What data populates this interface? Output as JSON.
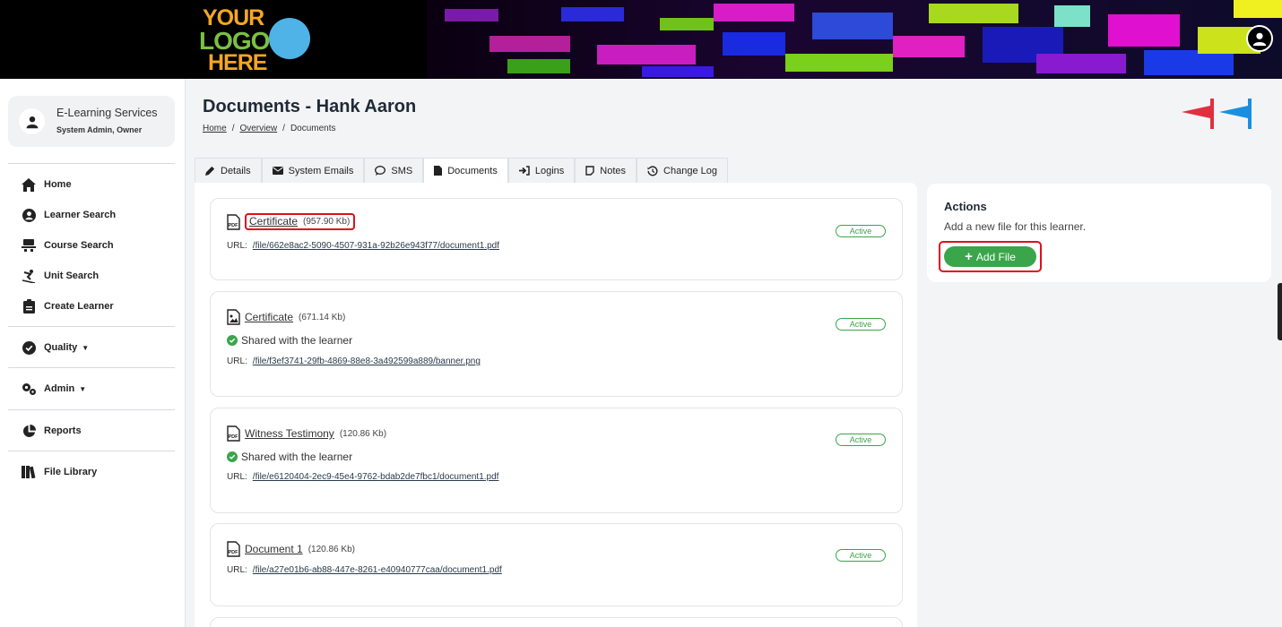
{
  "header": {
    "logo": {
      "line1": "YOUR",
      "line2": "LOGO",
      "line3": "HERE"
    }
  },
  "sidebar": {
    "profile": {
      "name": "E-Learning Services",
      "role": "System Admin, Owner"
    },
    "items": [
      {
        "label": "Home",
        "icon": "home-icon"
      },
      {
        "label": "Learner Search",
        "icon": "user-circle-icon"
      },
      {
        "label": "Course Search",
        "icon": "course-icon"
      },
      {
        "label": "Unit Search",
        "icon": "skier-icon"
      },
      {
        "label": "Create Learner",
        "icon": "clipboard-icon"
      },
      {
        "label": "Quality",
        "icon": "check-circle-icon",
        "dropdown": true
      },
      {
        "label": "Admin",
        "icon": "cogs-icon",
        "dropdown": true
      },
      {
        "label": "Reports",
        "icon": "pie-chart-icon"
      },
      {
        "label": "File Library",
        "icon": "books-icon"
      }
    ]
  },
  "page": {
    "title": "Documents - Hank Aaron",
    "breadcrumb": [
      {
        "label": "Home",
        "link": true
      },
      {
        "label": "Overview",
        "link": true
      },
      {
        "label": "Documents",
        "link": false
      }
    ],
    "separator": "/"
  },
  "tabs": [
    {
      "label": "Details",
      "icon": "pencil-icon"
    },
    {
      "label": "System Emails",
      "icon": "envelope-icon"
    },
    {
      "label": "SMS",
      "icon": "chat-icon"
    },
    {
      "label": "Documents",
      "icon": "document-icon",
      "active": true
    },
    {
      "label": "Logins",
      "icon": "sign-in-icon"
    },
    {
      "label": "Notes",
      "icon": "note-icon"
    },
    {
      "label": "Change Log",
      "icon": "history-icon"
    }
  ],
  "documents": [
    {
      "name": "Certificate",
      "size": "(957.90 Kb)",
      "type": "pdf",
      "shared": false,
      "url_label": "URL:",
      "url": "/file/662e8ac2-5090-4507-931a-92b26e943f77/document1.pdf",
      "status": "Active"
    },
    {
      "name": "Certificate",
      "size": "(671.14 Kb)",
      "type": "image",
      "shared": true,
      "shared_text": "Shared with the learner",
      "url_label": "URL:",
      "url": "/file/f3ef3741-29fb-4869-88e8-3a492599a889/banner.png",
      "status": "Active"
    },
    {
      "name": "Witness Testimony",
      "size": "(120.86 Kb)",
      "type": "pdf",
      "shared": true,
      "shared_text": "Shared with the learner",
      "url_label": "URL:",
      "url": "/file/e6120404-2ec9-45e4-9762-bdab2de7fbc1/document1.pdf",
      "status": "Active"
    },
    {
      "name": "Document 1",
      "size": "(120.86 Kb)",
      "type": "pdf",
      "shared": false,
      "url_label": "URL:",
      "url": "/file/a27e01b6-ab88-447e-8261-e40940777caa/document1.pdf",
      "status": "Active"
    }
  ],
  "actions": {
    "title": "Actions",
    "description": "Add a new file for this learner.",
    "add_button": {
      "label": "Add File",
      "icon": "plus-icon"
    }
  },
  "colors": {
    "accent_green": "#3aa54a",
    "highlight_red": "#e0101a",
    "flag_red": "#e03040",
    "flag_blue": "#1a8fe0"
  }
}
